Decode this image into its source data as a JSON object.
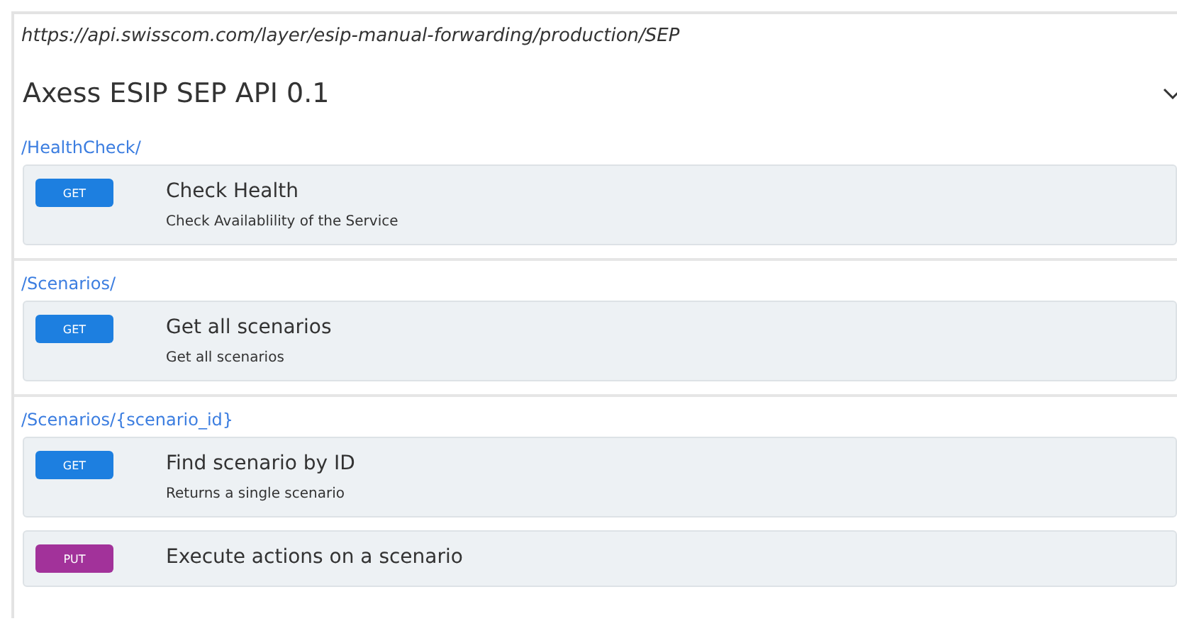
{
  "server_url": "https://api.swisscom.com/layer/esip-manual-forwarding/production/SEP",
  "api_title": "Axess ESIP SEP API 0.1",
  "expanded": true,
  "groups": [
    {
      "path": "/HealthCheck/",
      "operations": [
        {
          "method": "GET",
          "summary": "Check Health",
          "description": "Check Availablility of the Service"
        }
      ]
    },
    {
      "path": "/Scenarios/",
      "operations": [
        {
          "method": "GET",
          "summary": "Get all scenarios",
          "description": "Get all scenarios"
        }
      ]
    },
    {
      "path": "/Scenarios/{scenario_id}",
      "operations": [
        {
          "method": "GET",
          "summary": "Find scenario by ID",
          "description": "Returns a single scenario"
        },
        {
          "method": "PUT",
          "summary": "Execute actions on a scenario"
        }
      ]
    }
  ]
}
